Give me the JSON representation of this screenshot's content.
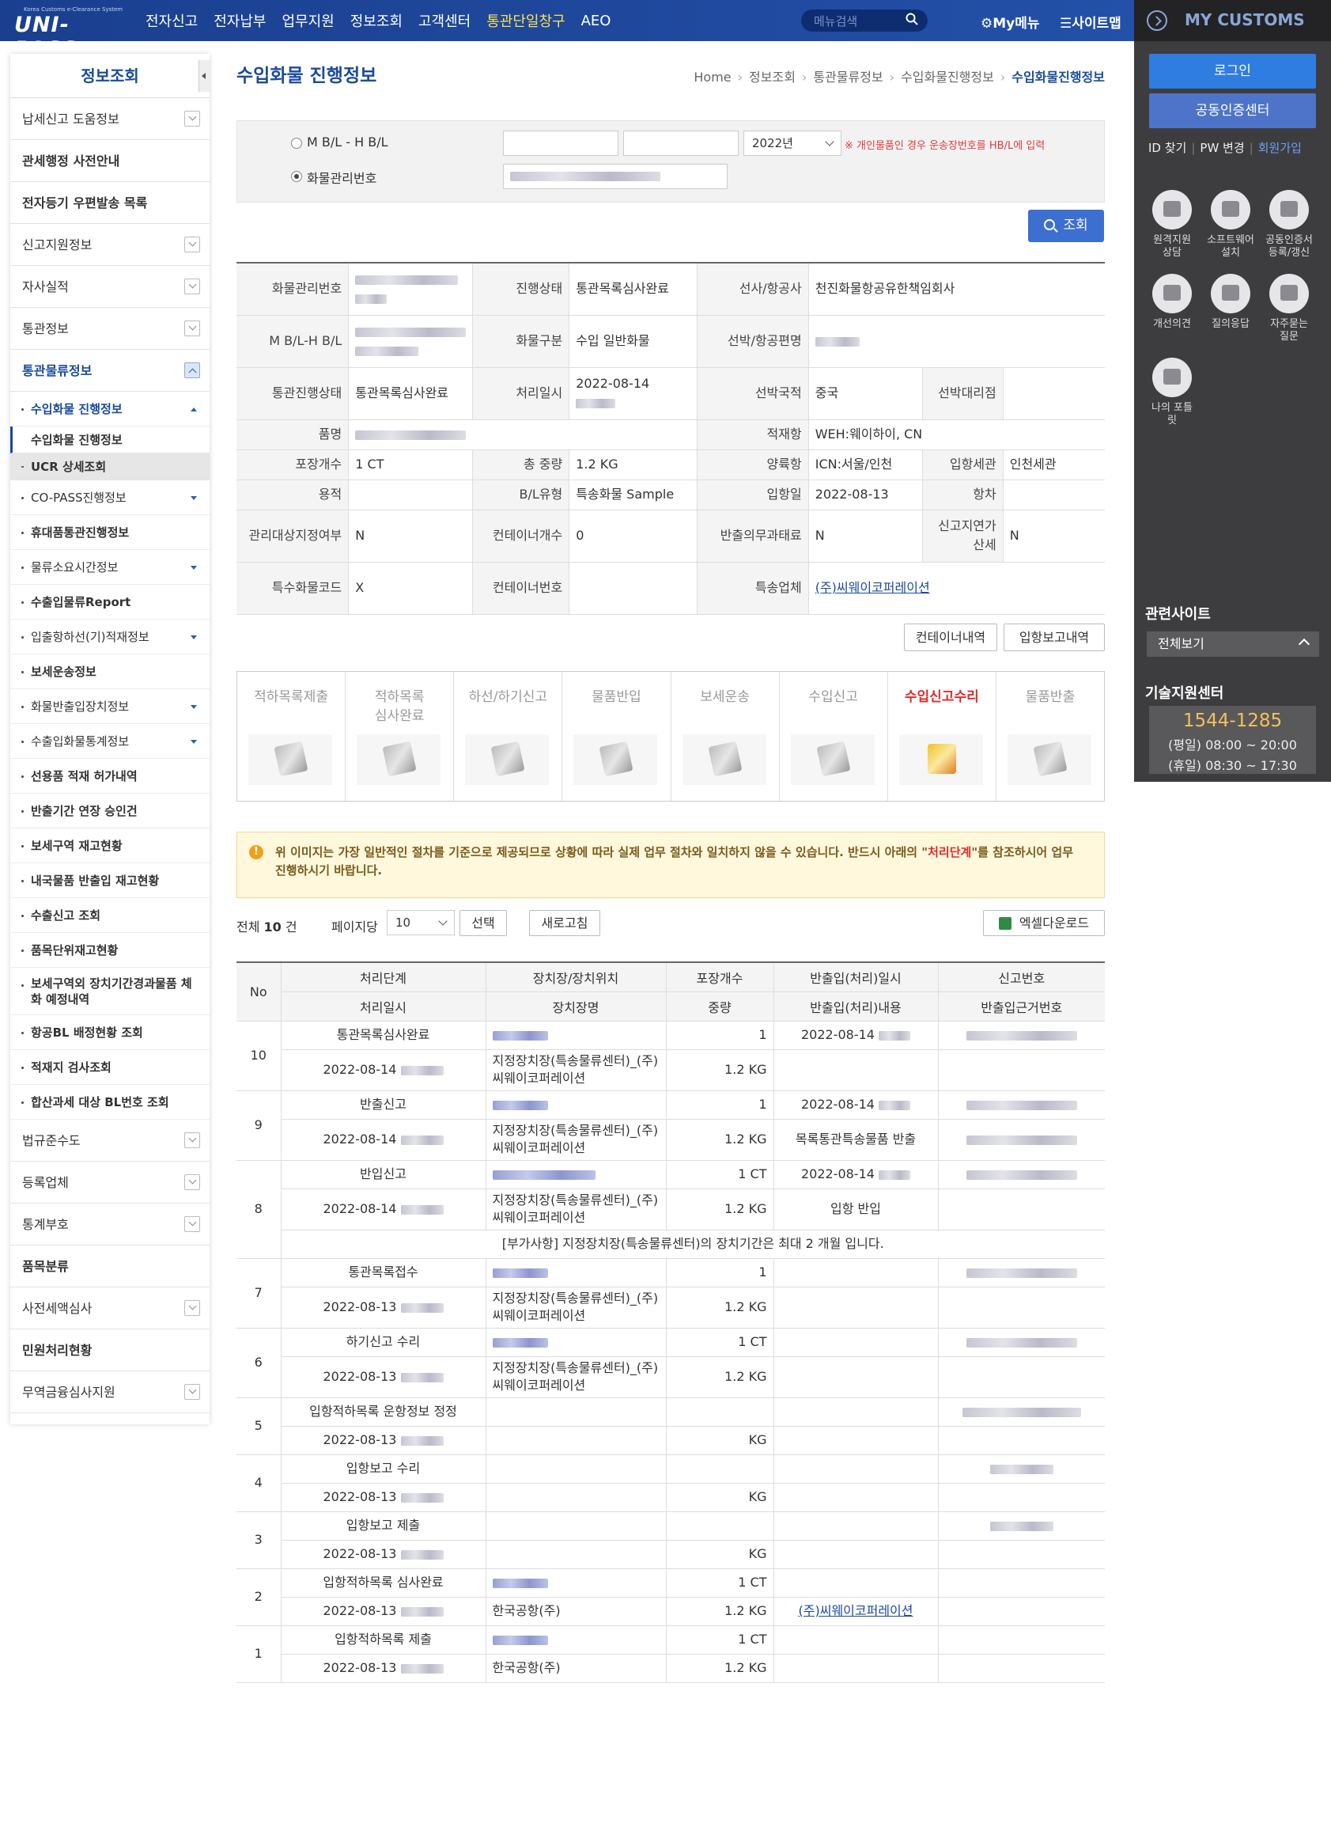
{
  "header": {
    "logo_tagline": "Korea Customs e-Clearance System",
    "logo": "UNI-PASS",
    "nav": [
      "전자신고",
      "전자납부",
      "업무지원",
      "정보조회",
      "고객센터",
      "통관단일창구",
      "AEO"
    ],
    "search_placeholder": "메뉴검색",
    "mymenu": "My메뉴",
    "sitemap": "사이트맵"
  },
  "right_panel": {
    "title": "MY CUSTOMS",
    "login": "로그인",
    "cert_center": "공동인증센터",
    "id_find": "ID 찾기",
    "pw_change": "PW 변경",
    "join": "회원가입",
    "icons": [
      {
        "label": "원격지원\n상담",
        "icon": "remote-support-icon"
      },
      {
        "label": "소프트웨어\n설치",
        "icon": "software-install-icon"
      },
      {
        "label": "공동인증서\n등록/갱신",
        "icon": "certificate-icon"
      },
      {
        "label": "개선의견",
        "icon": "feedback-icon"
      },
      {
        "label": "질의응답",
        "icon": "qna-icon"
      },
      {
        "label": "자주묻는\n질문",
        "icon": "faq-icon"
      },
      {
        "label": "나의 포틀\n릿",
        "icon": "portlet-icon"
      }
    ],
    "related_title": "관련사이트",
    "related_select": "전체보기",
    "tech_title": "기술지원센터",
    "phone": "1544-1285",
    "weekday": "(평일) 08:00 ~ 20:00",
    "holiday": "(휴일) 08:30 ~ 17:30"
  },
  "sidebar": {
    "title": "정보조회",
    "items_top": [
      {
        "label": "납세신고 도움정보",
        "dd": true,
        "bold": false
      },
      {
        "label": "관세행정 사전안내",
        "dd": false,
        "bold": true
      },
      {
        "label": "전자등기 우편발송 목록",
        "dd": false,
        "bold": true
      },
      {
        "label": "신고지원정보",
        "dd": true,
        "bold": false
      },
      {
        "label": "자사실적",
        "dd": true,
        "bold": false
      },
      {
        "label": "통관정보",
        "dd": true,
        "bold": false
      }
    ],
    "active_group": "통관물류정보",
    "sub_active": "수입화물 진행정보",
    "subsub": [
      "수입화물 진행정보",
      "UCR 상세조회"
    ],
    "sub_items": [
      {
        "label": "CO-PASS진행정보",
        "tri": true,
        "bold": false
      },
      {
        "label": "휴대품통관진행정보",
        "tri": false,
        "bold": true
      },
      {
        "label": "물류소요시간정보",
        "tri": true,
        "bold": false
      },
      {
        "label": "수출입물류Report",
        "tri": false,
        "bold": true
      },
      {
        "label": "입출항하선(기)적재정보",
        "tri": true,
        "bold": false
      },
      {
        "label": "보세운송정보",
        "tri": false,
        "bold": true
      },
      {
        "label": "화물반출입장치정보",
        "tri": true,
        "bold": false
      },
      {
        "label": "수출입화물통계정보",
        "tri": true,
        "bold": false
      },
      {
        "label": "선용품 적재 허가내역",
        "tri": false,
        "bold": true
      },
      {
        "label": "반출기간 연장 승인건",
        "tri": false,
        "bold": true
      },
      {
        "label": "보세구역 재고현황",
        "tri": false,
        "bold": true
      },
      {
        "label": "내국물품 반출입 재고현황",
        "tri": false,
        "bold": true
      },
      {
        "label": "수출신고 조회",
        "tri": false,
        "bold": true
      },
      {
        "label": "품목단위재고현황",
        "tri": false,
        "bold": true
      },
      {
        "label": "보세구역외 장치기간경과물품 체화 예정내역",
        "tri": false,
        "bold": true
      },
      {
        "label": "항공BL 배정현황 조회",
        "tri": false,
        "bold": true
      },
      {
        "label": "적재지 검사조회",
        "tri": false,
        "bold": true
      },
      {
        "label": "합산과세 대상 BL번호 조회",
        "tri": false,
        "bold": true
      }
    ],
    "items_bottom": [
      {
        "label": "법규준수도",
        "dd": true,
        "bold": false
      },
      {
        "label": "등록업체",
        "dd": true,
        "bold": false
      },
      {
        "label": "통계부호",
        "dd": true,
        "bold": false
      },
      {
        "label": "품목분류",
        "dd": false,
        "bold": true
      },
      {
        "label": "사전세액심사",
        "dd": true,
        "bold": false
      },
      {
        "label": "민원처리현황",
        "dd": false,
        "bold": true
      },
      {
        "label": "무역금융심사지원",
        "dd": true,
        "bold": false
      }
    ]
  },
  "page": {
    "title": "수입화물 진행정보",
    "breadcrumb": [
      "Home",
      "정보조회",
      "통관물류정보",
      "수입화물진행정보",
      "수입화물진행정보"
    ]
  },
  "search": {
    "radio_bl": "M B/L - H B/L",
    "radio_cargo": "화물관리번호",
    "year": "2022년",
    "note": "※ 개인물품인 경우 운송장번호를 HB/L에 입력",
    "button": "조회"
  },
  "info": {
    "labels": {
      "cargo_no": "화물관리번호",
      "status": "진행상태",
      "carrier": "선사/항공사",
      "mbl_hbl": "M B/L-H B/L",
      "cargo_type": "화물구분",
      "flight": "선박/항공편명",
      "clear_status": "통관진행상태",
      "proc_date": "처리일시",
      "nationality": "선박국적",
      "agent": "선박대리점",
      "goods": "품명",
      "load_port": "적재항",
      "pkg": "포장개수",
      "weight": "총 중량",
      "unload_port": "양륙항",
      "entry_customs": "입항세관",
      "volume": "용적",
      "bl_type": "B/L유형",
      "entry_date": "입항일",
      "voyage": "항차",
      "managed": "관리대상지정여부",
      "cont_cnt": "컨테이너개수",
      "carry_out_duty": "반출의무과태료",
      "late_tax": "신고지연가산세",
      "special_code": "특수화물코드",
      "cont_no": "컨테이너번호",
      "courier": "특송업체"
    },
    "values": {
      "status": "통관목록심사완료",
      "carrier": "천진화물항공유한책임회사",
      "cargo_type": "수입 일반화물",
      "clear_status": "통관목록심사완료",
      "proc_date": "2022-08-14",
      "nationality": "중국",
      "load_port": "WEH:웨이하이, CN",
      "pkg": "1 CT",
      "weight": "1.2 KG",
      "unload_port": "ICN:서울/인천",
      "entry_customs": "인천세관",
      "bl_type": "특송화물 Sample",
      "entry_date": "2022-08-13",
      "managed": "N",
      "cont_cnt": "0",
      "carry_out_duty": "N",
      "late_tax": "N",
      "special_code": "X",
      "courier": "(주)씨웨이코퍼레이션"
    },
    "btn_container": "컨테이너내역",
    "btn_entry": "입항보고내역"
  },
  "steps": {
    "items": [
      "적하목록제출",
      "적하목록\n심사완료",
      "하선/하기신고",
      "물품반입",
      "보세운송",
      "수입신고",
      "수입신고수리",
      "물품반출"
    ],
    "current": 6
  },
  "notice": {
    "text1": "위 이미지는 가장 일반적인 절차를 기준으로 제공되므로 상황에 따라 실제 업무 절차와 일치하지 않을 수 있습니다. 반드시 아래의 \"",
    "highlight": "처리단계",
    "text2": "\"를 참조하시어 업무 진행하시기 바랍니다."
  },
  "list": {
    "total_prefix": "전체",
    "total": "10",
    "total_suffix": "건",
    "per_page_label": "페이지당",
    "per_page": "10",
    "select_btn": "선택",
    "refresh_btn": "새로고침",
    "excel_btn": "엑셀다운로드",
    "headers": {
      "no": "No",
      "step": "처리단계",
      "loc": "장치장/장치위치",
      "pkg": "포장개수",
      "inout": "반출입(처리)일시",
      "decl": "신고번호",
      "date": "처리일시",
      "locname": "장치장명",
      "weight": "중량",
      "inout_desc": "반출입(처리)내용",
      "basis": "반출입근거번호"
    },
    "rows": [
      {
        "no": "10",
        "step": "통관목록심사완료",
        "pkg": "1",
        "inout": "2022-08-14",
        "date": "2022-08-14",
        "locname": "지정장치장(특송물류센터)_(주)씨웨이코퍼레이션",
        "weight": "1.2 KG",
        "desc": "",
        "courier": ""
      },
      {
        "no": "9",
        "step": "반출신고",
        "pkg": "1",
        "inout": "2022-08-14",
        "date": "2022-08-14",
        "locname": "지정장치장(특송물류센터)_(주)씨웨이코퍼레이션",
        "weight": "1.2 KG",
        "desc": "목록통관특송물품 반출",
        "courier": ""
      },
      {
        "no": "8",
        "step": "반입신고",
        "pkg": "1 CT",
        "inout": "2022-08-14",
        "date": "2022-08-14",
        "locname": "지정장치장(특송물류센터)_(주)씨웨이코퍼레이션",
        "weight": "1.2 KG",
        "desc": "입항 반입",
        "courier": "",
        "extra": "[부가사항] 지정장치장(특송물류센터)의 장치기간은 최대 2 개월 입니다."
      },
      {
        "no": "7",
        "step": "통관목록접수",
        "pkg": "1",
        "inout": "",
        "date": "2022-08-13",
        "locname": "지정장치장(특송물류센터)_(주)씨웨이코퍼레이션",
        "weight": "1.2 KG",
        "desc": "",
        "courier": ""
      },
      {
        "no": "6",
        "step": "하기신고 수리",
        "pkg": "1 CT",
        "inout": "",
        "date": "2022-08-13",
        "locname": "지정장치장(특송물류센터)_(주)씨웨이코퍼레이션",
        "weight": "1.2 KG",
        "desc": "",
        "courier": ""
      },
      {
        "no": "5",
        "step": "입항적하목록 운항정보 정정",
        "pkg": "",
        "inout": "",
        "date": "2022-08-13",
        "locname": "",
        "weight": "KG",
        "desc": "",
        "courier": ""
      },
      {
        "no": "4",
        "step": "입항보고 수리",
        "pkg": "",
        "inout": "",
        "date": "2022-08-13",
        "locname": "",
        "weight": "KG",
        "desc": "",
        "courier": ""
      },
      {
        "no": "3",
        "step": "입항보고 제출",
        "pkg": "",
        "inout": "",
        "date": "2022-08-13",
        "locname": "",
        "weight": "KG",
        "desc": "",
        "courier": ""
      },
      {
        "no": "2",
        "step": "입항적하목록 심사완료",
        "pkg": "1 CT",
        "inout": "",
        "date": "2022-08-13",
        "locname": "한국공항(주)",
        "weight": "1.2 KG",
        "desc": "",
        "courier": "(주)씨웨이코퍼레이션"
      },
      {
        "no": "1",
        "step": "입항적하목록 제출",
        "pkg": "1 CT",
        "inout": "",
        "date": "2022-08-13",
        "locname": "한국공항(주)",
        "weight": "1.2 KG",
        "desc": "",
        "courier": ""
      }
    ],
    "page": "1"
  }
}
